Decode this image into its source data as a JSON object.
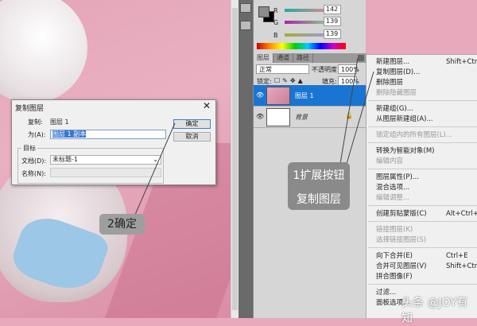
{
  "color_panel": {
    "r": "142",
    "g": "139",
    "b": "139",
    "r_label": "R",
    "g_label": "G",
    "b_label": "B"
  },
  "layers_panel": {
    "tabs": [
      "图层",
      "通道",
      "路径"
    ],
    "blend_mode": "正常",
    "opacity_label": "不透明度:",
    "opacity": "100%",
    "lock_label": "锁定:",
    "fill_label": "填充:",
    "fill": "100%",
    "layers": [
      {
        "name": "图层 1",
        "selected": true
      },
      {
        "name": "背景",
        "selected": false
      }
    ]
  },
  "menu": {
    "items": [
      {
        "label": "新建图层...",
        "shortcut": "Shift+Ctrl+N",
        "disabled": false
      },
      {
        "label": "复制图层(D)...",
        "disabled": false
      },
      {
        "label": "删除图层",
        "disabled": false
      },
      {
        "label": "删除隐藏图层",
        "disabled": true
      },
      {
        "label": "新建组(G)...",
        "disabled": false,
        "sep": true
      },
      {
        "label": "从图层新建组(A)...",
        "disabled": false
      },
      {
        "label": "锁定组内的所有图层(L)...",
        "disabled": true,
        "sep": true
      },
      {
        "label": "转换为智能对象(M)",
        "disabled": false,
        "sep": true
      },
      {
        "label": "编辑内容",
        "disabled": true
      },
      {
        "label": "图层属性(P)...",
        "disabled": false,
        "sep": true
      },
      {
        "label": "混合选项...",
        "disabled": false
      },
      {
        "label": "编辑调整...",
        "disabled": true
      },
      {
        "label": "创建剪贴蒙版(C)",
        "shortcut": "Alt+Ctrl+G",
        "disabled": false,
        "sep": true
      },
      {
        "label": "链接图层(K)",
        "disabled": true,
        "sep": true
      },
      {
        "label": "选择链接图层(S)",
        "disabled": true
      },
      {
        "label": "向下合并(E)",
        "shortcut": "Ctrl+E",
        "disabled": false,
        "sep": true
      },
      {
        "label": "合并可见图层(V)",
        "shortcut": "Shift+Ctrl+E",
        "disabled": false
      },
      {
        "label": "拼合图像(F)",
        "disabled": false
      },
      {
        "label": "过滤...",
        "disabled": false,
        "sep": true
      },
      {
        "label": "面板选项...",
        "disabled": false
      }
    ]
  },
  "dialog": {
    "title": "复制图层",
    "copy_label": "复制:",
    "copy_value": "图层 1",
    "as_label": "为(A):",
    "as_value": "图层 1 副本",
    "ok": "确定",
    "cancel": "取消",
    "target_label": "目标",
    "doc_label": "文档(D):",
    "doc_value": "未标题-1",
    "name_label": "名称(N):",
    "name_value": ""
  },
  "annotations": {
    "expand": "1扩展按钮",
    "duplicate": "复制图层",
    "confirm": "2确定"
  },
  "watermark": "头条 @JOY有知"
}
